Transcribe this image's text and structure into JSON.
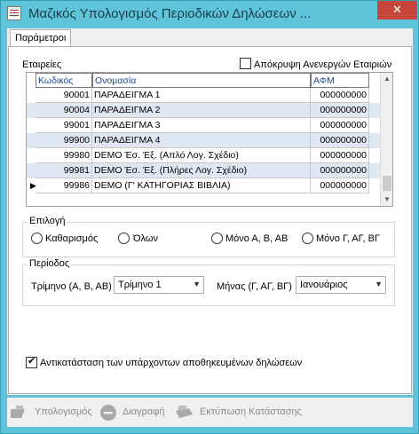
{
  "window": {
    "title": "Μαζικός Υπολογισμός Περιοδικών Δηλώσεων ...",
    "close_glyph": "✕"
  },
  "tabs": [
    {
      "label": "Παράμετροι"
    }
  ],
  "companies": {
    "section_label": "Εταιρείες",
    "hide_inactive_label": "Απόκρυψη Ανενεργών Εταιριών",
    "hide_inactive_checked": false,
    "columns": [
      "Κωδικός",
      "Ονομασία",
      "ΑΦΜ"
    ],
    "rows": [
      {
        "code": "90001",
        "name": "ΠΑΡΑΔΕΙΓΜΑ 1",
        "afm": "000000000"
      },
      {
        "code": "90004",
        "name": "ΠΑΡΑΔΕΙΓΜΑ 2",
        "afm": "000000000"
      },
      {
        "code": "99001",
        "name": "ΠΑΡΑΔΕΙΓΜΑ 3",
        "afm": "000000000"
      },
      {
        "code": "99900",
        "name": "ΠΑΡΑΔΕΙΓΜΑ 4",
        "afm": "000000000"
      },
      {
        "code": "99980",
        "name": "DEMO Έσ. Έξ. (Απλό Λογ. Σχέδιο)",
        "afm": "000000000"
      },
      {
        "code": "99981",
        "name": "DEMO Έσ. Έξ. (Πλήρες Λογ. Σχέδιο)",
        "afm": "000000000"
      },
      {
        "code": "99986",
        "name": "DEMO  (Γ' ΚΑΤΗΓΟΡΙΑΣ ΒΙΒΛΙΑ)",
        "afm": "000000000"
      }
    ],
    "current_row_marker": "▶"
  },
  "selection": {
    "group_label": "Επιλογή",
    "options": [
      "Καθαρισμός",
      "Όλων",
      "Μόνο Α, Β, ΑΒ",
      "Μόνο Γ, ΑΓ, ΒΓ"
    ]
  },
  "period": {
    "group_label": "Περίοδος",
    "quarter_label": "Τρίμηνο (Α, Β, ΑΒ)",
    "quarter_value": "Τρίμηνο 1",
    "month_label": "Μήνας (Γ, ΑΓ, ΒΓ)",
    "month_value": "Ιανουάριος"
  },
  "replace": {
    "label": "Αντικατάσταση των υπάρχοντων αποθηκευμένων δηλώσεων",
    "checked": true
  },
  "toolbar": {
    "calculate_label": "Υπολογισμός",
    "delete_label": "Διαγραφή",
    "print_label": "Εκτύπωση Κατάστασης"
  },
  "colors": {
    "frame": "#5ec4d9",
    "close": "#c7463c",
    "alt_row": "#dfe7f3",
    "header_text": "#1a4a96"
  }
}
